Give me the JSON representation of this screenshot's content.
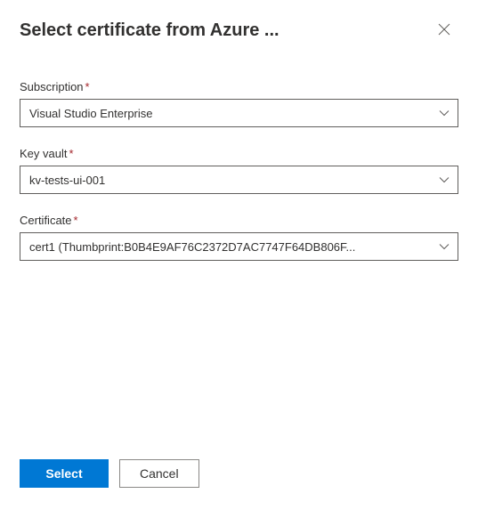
{
  "header": {
    "title": "Select certificate from Azure ..."
  },
  "fields": {
    "subscription": {
      "label": "Subscription",
      "required": "*",
      "value": "Visual Studio Enterprise"
    },
    "keyVault": {
      "label": "Key vault",
      "required": "*",
      "value": "kv-tests-ui-001"
    },
    "certificate": {
      "label": "Certificate",
      "required": "*",
      "value": "cert1 (Thumbprint:B0B4E9AF76C2372D7AC7747F64DB806F..."
    }
  },
  "footer": {
    "primary": "Select",
    "secondary": "Cancel"
  }
}
